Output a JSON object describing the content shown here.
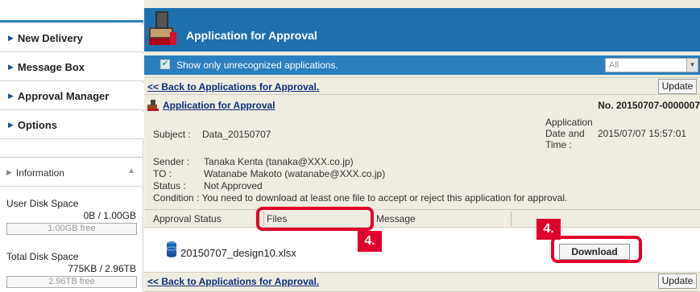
{
  "sidebar": {
    "items": [
      {
        "label": "New Delivery"
      },
      {
        "label": "Message Box"
      },
      {
        "label": "Approval Manager"
      },
      {
        "label": "Options"
      }
    ],
    "info": {
      "label": "Information",
      "user_disk_label": "User Disk Space",
      "user_disk_value": "0B / 1.00GB",
      "user_disk_free": "1.00GB free",
      "total_disk_label": "Total Disk Space",
      "total_disk_value": "775KB / 2.96TB",
      "total_disk_free": "2.96TB free"
    }
  },
  "header": {
    "title": "Application for Approval",
    "filter_label": "Show only unrecognized applications.",
    "filter_checked": true,
    "select_value": "All"
  },
  "nav": {
    "back_link": "<< Back to Applications for Approval.",
    "update_label": "Update"
  },
  "application": {
    "heading": "Application for Approval",
    "number": "No. 20150707-0000007",
    "subject_label": "Subject :",
    "subject_value": "Data_20150707",
    "app_datetime_label_1": "Application",
    "app_datetime_label_2": "Date and",
    "app_datetime_label_3": "Time :",
    "app_datetime_value": "2015/07/07 15:57:01",
    "sender_label": "Sender :",
    "sender_value": "Tanaka Kenta (tanaka@XXX.co.jp)",
    "to_label": "TO :",
    "to_value": "Watanabe Makoto (watanabe@XXX.co.jp)",
    "status_label": "Status :",
    "status_value": "Not Approved",
    "condition": "Condition : You need to download at least one file to accept or reject this application for approval."
  },
  "table": {
    "columns": [
      "Approval Status",
      "Files",
      "Message"
    ],
    "file_name": "20150707_design10.xlsx",
    "download_label": "Download"
  },
  "annotations": {
    "badge_files": "4.",
    "badge_download": "4.",
    "highlight_color": "#e0002b"
  },
  "colors": {
    "titlebar": "#1e6fae",
    "filterbar": "#2a7fbf",
    "panel": "#efece1",
    "link": "#0d2f7a"
  }
}
